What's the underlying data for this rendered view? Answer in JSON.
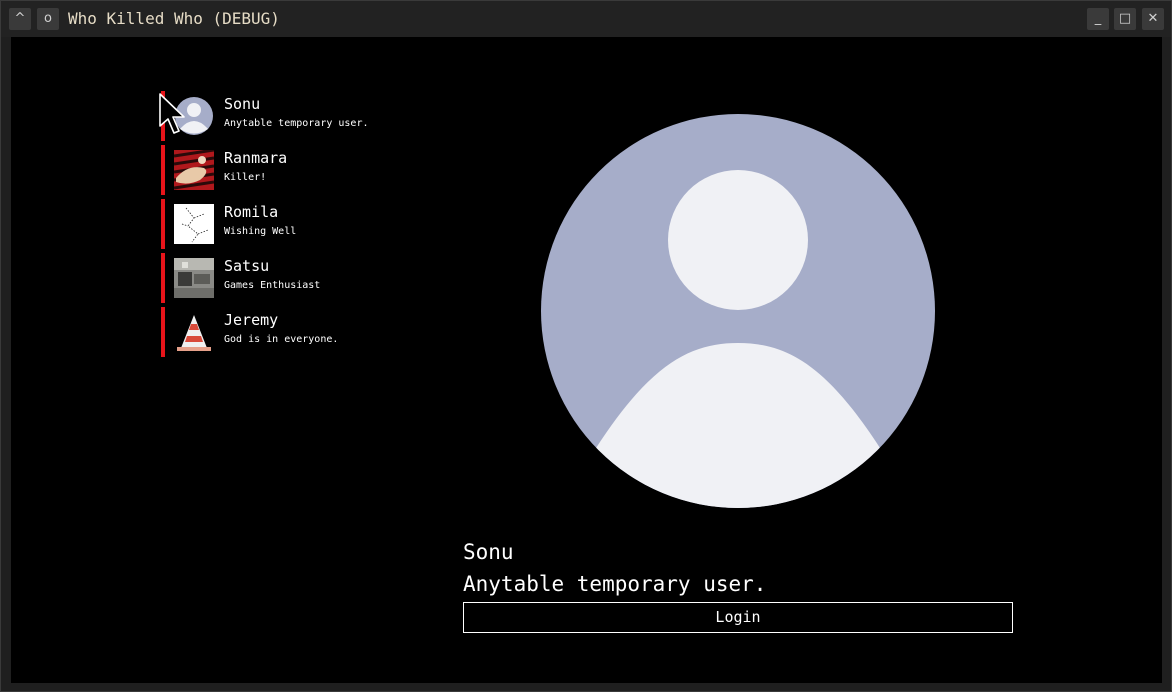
{
  "window": {
    "title": "Who Killed Who (DEBUG)",
    "controls": {
      "collapse": "^",
      "menu": "o",
      "minimize": "_",
      "maximize": "□",
      "close": "✕"
    }
  },
  "users": [
    {
      "name": "Sonu",
      "status": "Anytable temporary user.",
      "avatar": "default-avatar"
    },
    {
      "name": "Ranmara",
      "status": "Killer!",
      "avatar": "red-art-avatar"
    },
    {
      "name": "Romila",
      "status": "Wishing Well",
      "avatar": "sketch-avatar"
    },
    {
      "name": "Satsu",
      "status": "Games Enthusiast",
      "avatar": "photo-avatar"
    },
    {
      "name": "Jeremy",
      "status": "God is in everyone.",
      "avatar": "cone-avatar"
    }
  ],
  "selected": {
    "name": "Sonu",
    "status": "Anytable temporary user.",
    "login_label": "Login"
  },
  "colors": {
    "accent_bar": "#e8141a",
    "avatar_bg": "#a6adc9",
    "avatar_fg": "#f0f1f5",
    "background": "#000000"
  }
}
